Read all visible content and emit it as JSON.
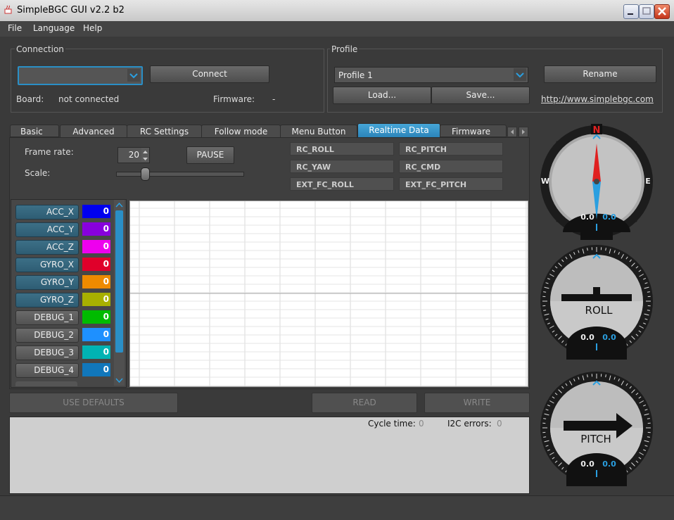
{
  "window": {
    "title": "SimpleBGC GUI v2.2 b2"
  },
  "menu": [
    "File",
    "Language",
    "Help"
  ],
  "connection": {
    "label": "Connection",
    "port_value": "",
    "connect_label": "Connect",
    "board_label": "Board:",
    "board_value": "not connected",
    "firmware_label": "Firmware:",
    "firmware_value": "-"
  },
  "profile": {
    "label": "Profile",
    "selected": "Profile 1",
    "rename_label": "Rename",
    "load_label": "Load...",
    "save_label": "Save...",
    "link": "http://www.simplebgc.com"
  },
  "tabs": [
    "Basic",
    "Advanced",
    "RC Settings",
    "Follow mode",
    "Menu Button",
    "Realtime Data",
    "Firmware u..."
  ],
  "realtime": {
    "frame_rate_label": "Frame rate:",
    "frame_rate_value": "20",
    "scale_label": "Scale:",
    "scale_level": 0.2,
    "pause_label": "PAUSE",
    "rc_buttons": [
      "RC_ROLL",
      "RC_PITCH",
      "RC_YAW",
      "RC_CMD",
      "EXT_FC_ROLL",
      "EXT_FC_PITCH"
    ],
    "channels": [
      {
        "name": "ACC_X",
        "value": "0",
        "color": "#0000ee",
        "active": true
      },
      {
        "name": "ACC_Y",
        "value": "0",
        "color": "#8800dd",
        "active": true
      },
      {
        "name": "ACC_Z",
        "value": "0",
        "color": "#ee00ee",
        "active": true
      },
      {
        "name": "GYRO_X",
        "value": "0",
        "color": "#e0002a",
        "active": true
      },
      {
        "name": "GYRO_Y",
        "value": "0",
        "color": "#ee8a00",
        "active": true
      },
      {
        "name": "GYRO_Z",
        "value": "0",
        "color": "#a8b000",
        "active": true
      },
      {
        "name": "DEBUG_1",
        "value": "0",
        "color": "#00bb00",
        "active": false
      },
      {
        "name": "DEBUG_2",
        "value": "0",
        "color": "#1e90ff",
        "active": false
      },
      {
        "name": "DEBUG_3",
        "value": "0",
        "color": "#00b3b3",
        "active": false
      },
      {
        "name": "DEBUG_4",
        "value": "0",
        "color": "#1177bb",
        "active": false
      }
    ]
  },
  "actions": {
    "use_defaults": "USE DEFAULTS",
    "read": "READ",
    "write": "WRITE"
  },
  "status": {
    "cycle_label": "Cycle time:",
    "cycle_value": "0",
    "i2c_label": "I2C errors:",
    "i2c_value": "0"
  },
  "gauges": {
    "compass": {
      "n": "N",
      "w": "W",
      "e": "E",
      "v1": "0.0",
      "v2": "0.0"
    },
    "roll": {
      "label": "ROLL",
      "v1": "0.0",
      "v2": "0.0"
    },
    "pitch": {
      "label": "PITCH",
      "v1": "0.0",
      "v2": "0.0"
    }
  },
  "colors": {
    "accent": "#2a8fc6",
    "value_blue": "#2a9fe0",
    "compass_red": "#e02020"
  }
}
